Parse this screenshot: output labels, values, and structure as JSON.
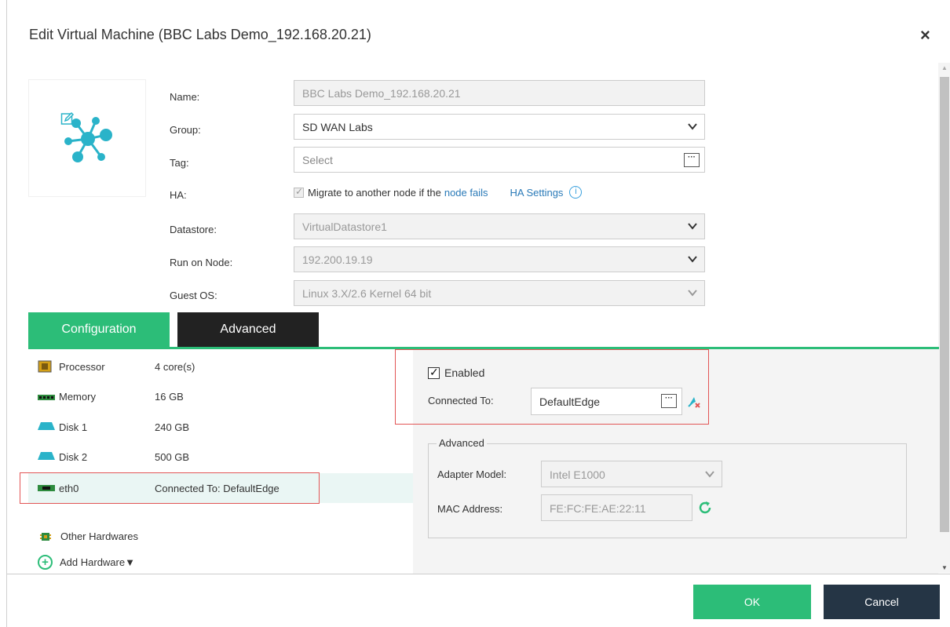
{
  "dialog": {
    "title": "Edit Virtual Machine (BBC Labs Demo_192.168.20.21)",
    "close_glyph": "×"
  },
  "form": {
    "name_label": "Name:",
    "name_value": "BBC Labs Demo_192.168.20.21",
    "group_label": "Group:",
    "group_value": "SD WAN Labs",
    "tag_label": "Tag:",
    "tag_placeholder": "Select",
    "ha_label": "HA:",
    "ha_text": "Migrate to another node if the",
    "ha_link": "node fails",
    "ha_settings": "HA Settings",
    "ha_info": "i",
    "datastore_label": "Datastore:",
    "datastore_value": "VirtualDatastore1",
    "node_label": "Run on Node:",
    "node_value": "192.200.19.19",
    "os_label": "Guest OS:",
    "os_value": "Linux 3.X/2.6 Kernel 64 bit",
    "dots": "···"
  },
  "tabs": {
    "configuration": "Configuration",
    "advanced": "Advanced"
  },
  "hardware": [
    {
      "name": "Processor",
      "value": "4 core(s)",
      "icon": "processor-icon"
    },
    {
      "name": "Memory",
      "value": "16 GB",
      "icon": "memory-icon"
    },
    {
      "name": "Disk 1",
      "value": "240 GB",
      "icon": "disk-icon"
    },
    {
      "name": "Disk 2",
      "value": "500 GB",
      "icon": "disk-icon"
    },
    {
      "name": "eth0",
      "value": "Connected To: DefaultEdge",
      "icon": "network-card-icon"
    }
  ],
  "other_hardwares": "Other Hardwares",
  "add_hardware": "Add Hardware▼",
  "nic": {
    "enabled_label": "Enabled",
    "connected_label": "Connected To:",
    "connected_value": "DefaultEdge",
    "advanced_legend": "Advanced",
    "adapter_label": "Adapter Model:",
    "adapter_value": "Intel E1000",
    "mac_label": "MAC Address:",
    "mac_value": "FE:FC:FE:AE:22:11"
  },
  "footer": {
    "ok": "OK",
    "cancel": "Cancel"
  },
  "colors": {
    "accent_green": "#2cbd78",
    "dark_tab": "#222222",
    "cancel_bg": "#253545",
    "link_blue": "#2a7ab8",
    "highlight_red": "#e25555"
  }
}
